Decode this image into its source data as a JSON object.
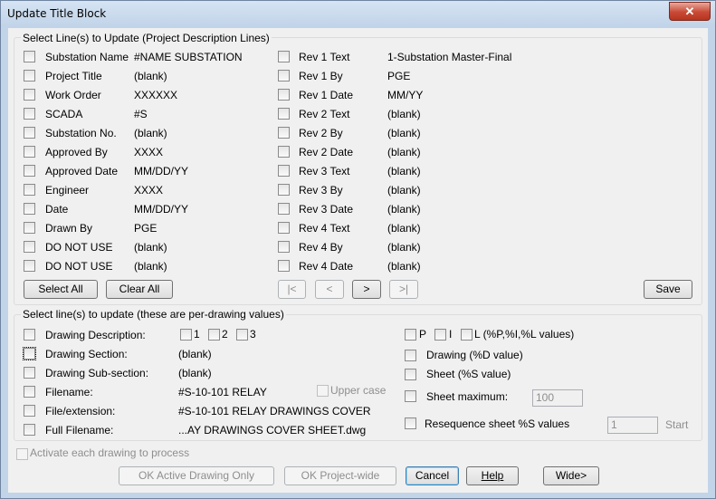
{
  "window": {
    "title": "Update Title Block",
    "close_glyph": "✕"
  },
  "project_group": {
    "label": "Select Line(s) to Update (Project Description Lines)",
    "left_rows": [
      {
        "label": "Substation Name",
        "value": "#NAME SUBSTATION"
      },
      {
        "label": "Project Title",
        "value": "(blank)"
      },
      {
        "label": "Work Order",
        "value": "XXXXXX"
      },
      {
        "label": "SCADA",
        "value": "#S"
      },
      {
        "label": "Substation No.",
        "value": "(blank)"
      },
      {
        "label": "Approved By",
        "value": "XXXX"
      },
      {
        "label": "Approved Date",
        "value": "MM/DD/YY"
      },
      {
        "label": "Engineer",
        "value": "XXXX"
      },
      {
        "label": "Date",
        "value": "MM/DD/YY"
      },
      {
        "label": "Drawn By",
        "value": "PGE"
      },
      {
        "label": "DO NOT USE",
        "value": "(blank)"
      },
      {
        "label": "DO NOT USE",
        "value": "(blank)"
      }
    ],
    "right_rows": [
      {
        "label": "Rev 1 Text",
        "value": "1-Substation Master-Final"
      },
      {
        "label": "Rev 1 By",
        "value": "PGE"
      },
      {
        "label": "Rev 1 Date",
        "value": "MM/YY"
      },
      {
        "label": "Rev 2 Text",
        "value": "(blank)"
      },
      {
        "label": "Rev 2 By",
        "value": "(blank)"
      },
      {
        "label": "Rev 2 Date",
        "value": "(blank)"
      },
      {
        "label": "Rev 3 Text",
        "value": "(blank)"
      },
      {
        "label": "Rev 3 By",
        "value": "(blank)"
      },
      {
        "label": "Rev 3 Date",
        "value": "(blank)"
      },
      {
        "label": "Rev 4 Text",
        "value": "(blank)"
      },
      {
        "label": "Rev 4 By",
        "value": "(blank)"
      },
      {
        "label": "Rev 4 Date",
        "value": "(blank)"
      }
    ],
    "select_all": "Select All",
    "clear_all": "Clear All",
    "nav_first": "|<",
    "nav_prev": "<",
    "nav_next": ">",
    "nav_last": ">|",
    "save": "Save"
  },
  "drawing_group": {
    "label": "Select line(s) to update (these are per-drawing values)",
    "rows": [
      {
        "label": "Drawing Description:",
        "value": ""
      },
      {
        "label": "Drawing Section:",
        "value": "(blank)"
      },
      {
        "label": "Drawing Sub-section:",
        "value": "(blank)"
      },
      {
        "label": "Filename:",
        "value": "#S-10-101 RELAY"
      },
      {
        "label": "File/extension:",
        "value": "#S-10-101 RELAY DRAWINGS COVER"
      },
      {
        "label": "Full Filename:",
        "value": "...AY DRAWINGS COVER SHEET.dwg"
      }
    ],
    "desc_opts": [
      "1",
      "2",
      "3"
    ],
    "upper_case": "Upper case",
    "pil": [
      "P",
      "I",
      "L (%P,%I,%L values)"
    ],
    "drawing_d": "Drawing (%D value)",
    "sheet_s": "Sheet (%S value)",
    "sheet_max": "Sheet maximum:",
    "sheet_max_value": "100",
    "resequence": "Resequence sheet %S values",
    "reseq_value": "1",
    "start": "Start"
  },
  "footer": {
    "activate": "Activate each drawing to process",
    "ok_active": "OK Active Drawing Only",
    "ok_project": "OK Project-wide",
    "cancel": "Cancel",
    "help": "Help",
    "wide": "Wide>"
  }
}
